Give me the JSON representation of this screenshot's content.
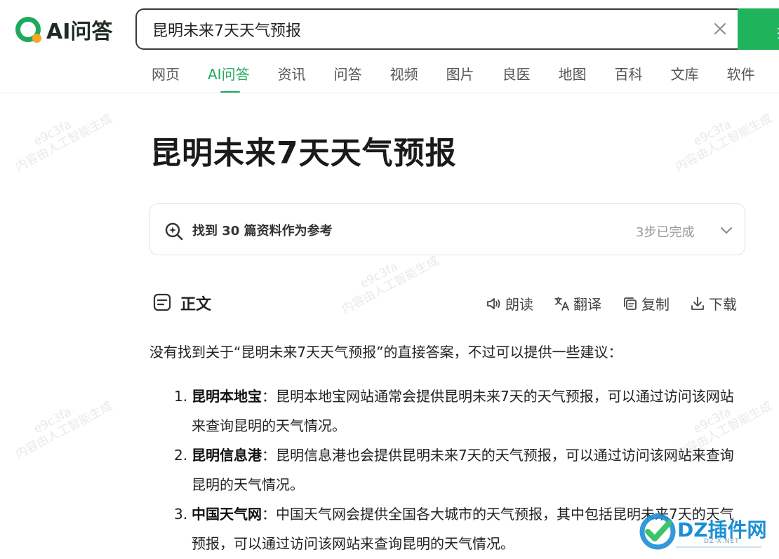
{
  "header": {
    "logo_text": "AI问答",
    "search_value": "昆明未来7天天气预报",
    "search_button_label": "搜"
  },
  "tabs": [
    {
      "label": "网页",
      "active": false
    },
    {
      "label": "AI问答",
      "active": true
    },
    {
      "label": "资讯",
      "active": false
    },
    {
      "label": "问答",
      "active": false
    },
    {
      "label": "视频",
      "active": false
    },
    {
      "label": "图片",
      "active": false
    },
    {
      "label": "良医",
      "active": false
    },
    {
      "label": "地图",
      "active": false
    },
    {
      "label": "百科",
      "active": false
    },
    {
      "label": "文库",
      "active": false
    },
    {
      "label": "软件",
      "active": false
    }
  ],
  "watermark": {
    "code": "e9c3fa",
    "text": "内容由人工智能生成"
  },
  "page_title": "昆明未来7天天气预报",
  "references": {
    "text": "找到 30 篇资料作为参考",
    "status": "3步已完成"
  },
  "section": {
    "title": "正文",
    "actions": {
      "read": "朗读",
      "translate": "翻译",
      "copy": "复制",
      "download": "下载"
    }
  },
  "answer": {
    "intro": "没有找到关于“昆明未来7天天气预报”的直接答案，不过可以提供一些建议：",
    "items": [
      {
        "num": "1.",
        "name": "昆明本地宝",
        "sep": "：",
        "text": "昆明本地宝网站通常会提供昆明未来7天的天气预报，可以通过访问该网站来查询昆明的天气情况。"
      },
      {
        "num": "2.",
        "name": "昆明信息港",
        "sep": "：",
        "text": "昆明信息港也会提供昆明未来7天的天气预报，可以通过访问该网站来查询昆明的天气情况。"
      },
      {
        "num": "3.",
        "name": "中国天气网",
        "sep": "：",
        "text": "中国天气网会提供全国各大城市的天气预报，其中包括昆明未来7天的天气预报，可以通过访问该网站来查询昆明的天气情况。"
      }
    ]
  },
  "corner_logo": {
    "text": "DZ插件网",
    "sub": "DZ-X.NET"
  },
  "colors": {
    "accent": "#1fa95b",
    "search_button": "#1fb35c",
    "logo_dot": "#f5a623",
    "corner_blue": "#1b8fd6"
  }
}
